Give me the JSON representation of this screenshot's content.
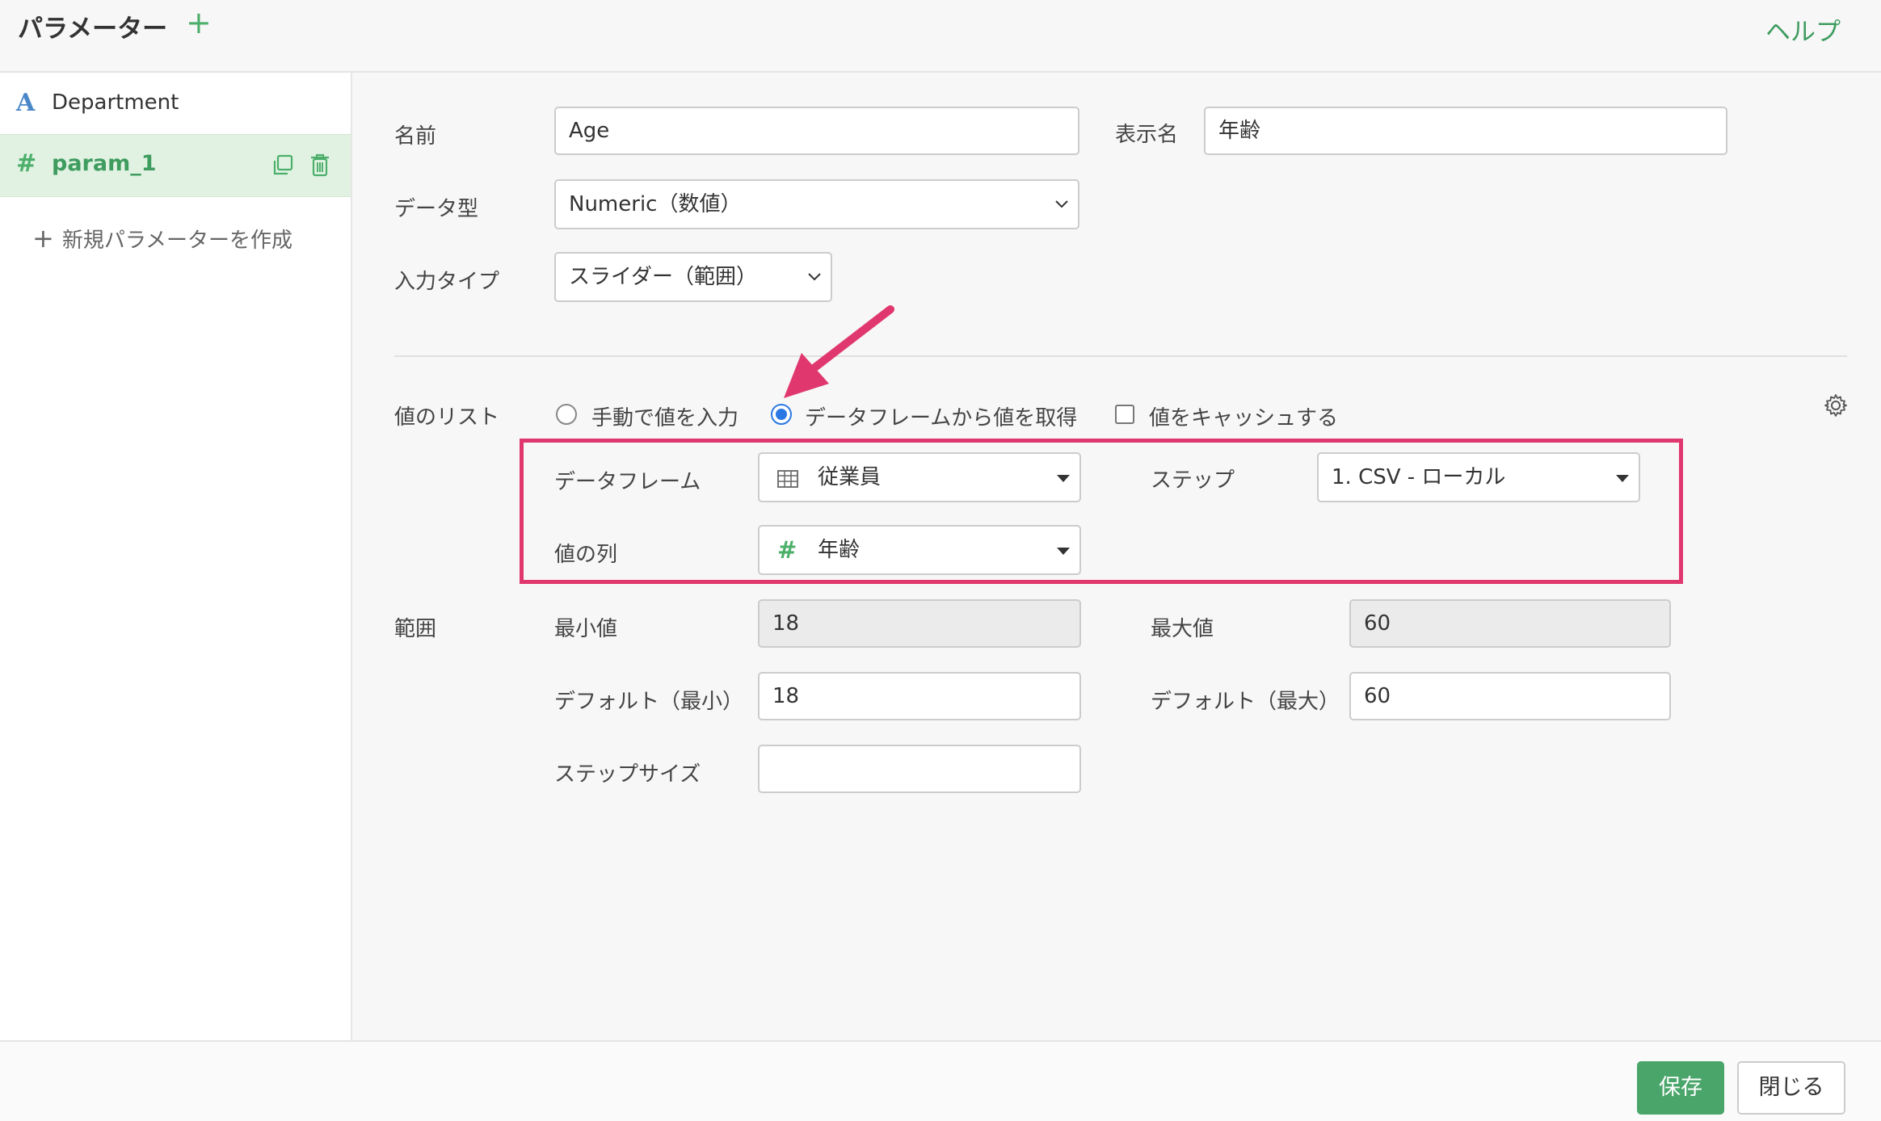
{
  "header": {
    "title": "パラメーター",
    "add_symbol": "+",
    "help": "ヘルプ"
  },
  "sidebar": {
    "items": [
      {
        "type_icon": "A",
        "label": "Department"
      },
      {
        "type_icon": "#",
        "label": "param_1"
      }
    ],
    "new_param": "新規パラメーターを作成",
    "new_param_symbol": "+"
  },
  "form": {
    "name_label": "名前",
    "name_value": "Age",
    "display_name_label": "表示名",
    "display_name_value": "年齢",
    "data_type_label": "データ型",
    "data_type_value": "Numeric（数値）",
    "input_type_label": "入力タイプ",
    "input_type_value": "スライダー（範囲）",
    "value_list_label": "値のリスト",
    "radio_manual": "手動で値を入力",
    "radio_dataframe": "データフレームから値を取得",
    "checkbox_cache": "値をキャッシュする",
    "dataframe_label": "データフレーム",
    "dataframe_value": "従業員",
    "step_label": "ステップ",
    "step_value": "1. CSV - ローカル",
    "value_column_label": "値の列",
    "value_column_type": "#",
    "value_column_value": "年齢",
    "range_label": "範囲",
    "min_label": "最小値",
    "min_value": "18",
    "max_label": "最大値",
    "max_value": "60",
    "default_min_label": "デフォルト（最小）",
    "default_min_value": "18",
    "default_max_label": "デフォルト（最大）",
    "default_max_value": "60",
    "step_size_label": "ステップサイズ",
    "step_size_value": ""
  },
  "footer": {
    "save": "保存",
    "close": "閉じる"
  },
  "colors": {
    "accent_green": "#4aa56a",
    "highlight_pink": "#e0386e",
    "radio_blue": "#2b78e4",
    "type_a_blue": "#4a87c8"
  },
  "icons": [
    "table-icon",
    "gear-icon",
    "copy-icon",
    "trash-icon",
    "chevron-down-icon",
    "caret-down-icon"
  ]
}
